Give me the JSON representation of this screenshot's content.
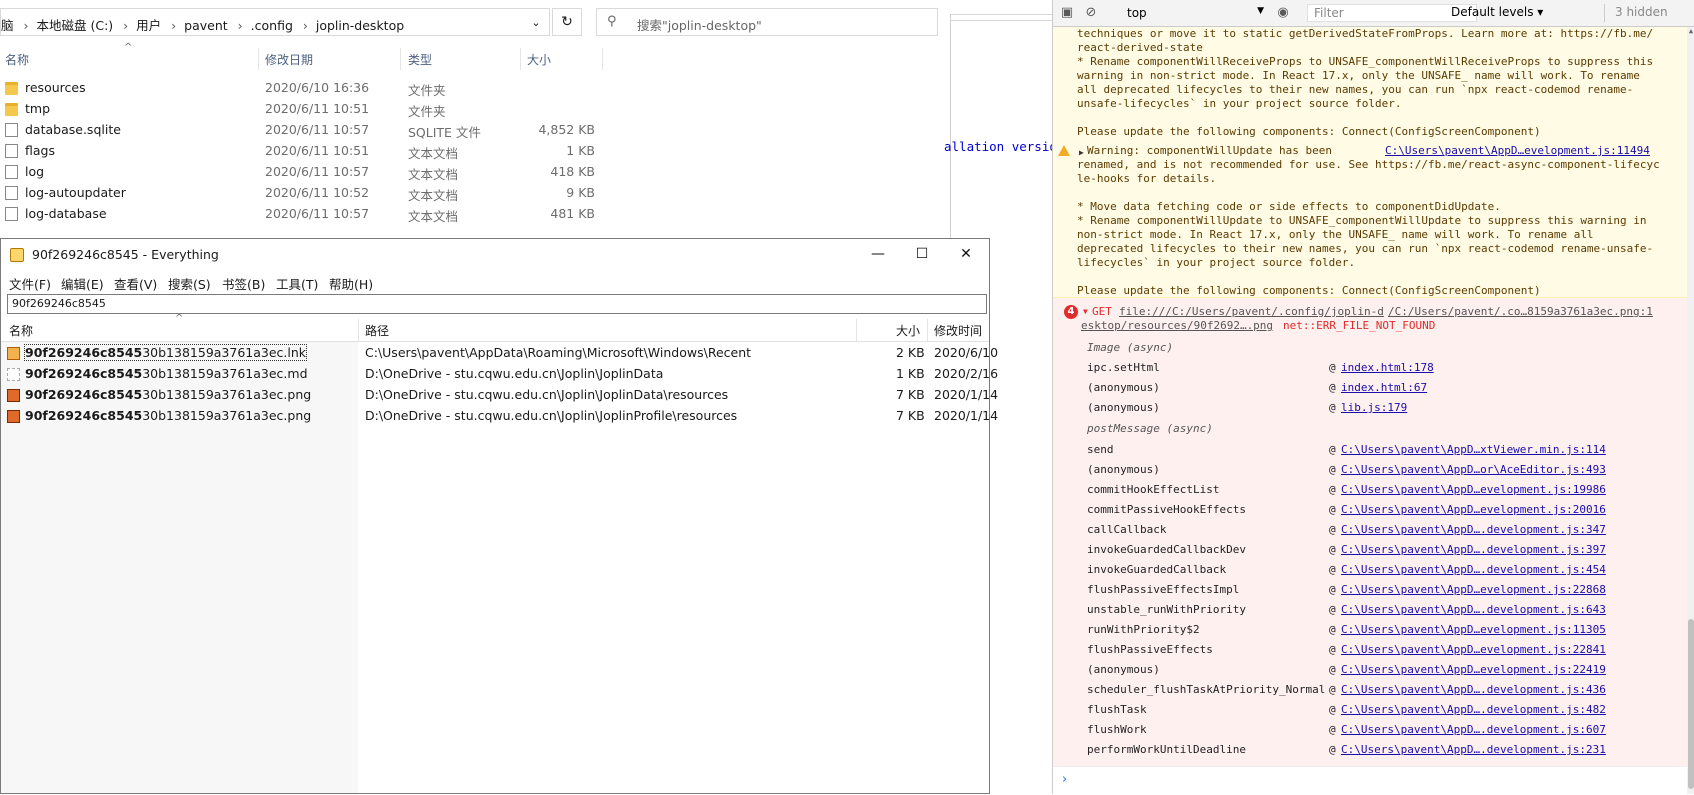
{
  "explorer": {
    "breadcrumbs": [
      "脑",
      "本地磁盘 (C:)",
      "用户",
      "pavent",
      ".config",
      "joplin-desktop"
    ],
    "search_placeholder": "搜索\"joplin-desktop\"",
    "columns": {
      "name": "名称",
      "date": "修改日期",
      "type": "类型",
      "size": "大小"
    },
    "rows": [
      {
        "name": "resources",
        "date": "2020/6/10 16:36",
        "type": "文件夹",
        "size": "",
        "icon": "folder-icon"
      },
      {
        "name": "tmp",
        "date": "2020/6/11 10:51",
        "type": "文件夹",
        "size": "",
        "icon": "folder-icon"
      },
      {
        "name": "database.sqlite",
        "date": "2020/6/11 10:57",
        "type": "SQLITE 文件",
        "size": "4,852 KB",
        "icon": "file-icon"
      },
      {
        "name": "flags",
        "date": "2020/6/11 10:51",
        "type": "文本文档",
        "size": "1 KB",
        "icon": "file-icon"
      },
      {
        "name": "log",
        "date": "2020/6/11 10:57",
        "type": "文本文档",
        "size": "418 KB",
        "icon": "file-icon"
      },
      {
        "name": "log-autoupdater",
        "date": "2020/6/11 10:52",
        "type": "文本文档",
        "size": "9 KB",
        "icon": "file-icon"
      },
      {
        "name": "log-database",
        "date": "2020/6/11 10:57",
        "type": "文本文档",
        "size": "481 KB",
        "icon": "file-icon"
      }
    ],
    "clipped_text": "allation versio"
  },
  "everything": {
    "title": "90f269246c8545 - Everything",
    "menu": [
      "文件(F)",
      "编辑(E)",
      "查看(V)",
      "搜索(S)",
      "书签(B)",
      "工具(T)",
      "帮助(H)"
    ],
    "search_value": "90f269246c8545",
    "columns": {
      "name": "名称",
      "path": "路径",
      "size": "大小",
      "modified": "修改时间"
    },
    "rows": [
      {
        "match": "90f269246c8545",
        "rest": "30b138159a3761a3ec.lnk",
        "path": "C:\\Users\\pavent\\AppData\\Roaming\\Microsoft\\Windows\\Recent",
        "size": "2 KB",
        "modified": "2020/6/10",
        "icon": "shortcut-icon"
      },
      {
        "match": "90f269246c8545",
        "rest": "30b138159a3761a3ec.md",
        "path": "D:\\OneDrive - stu.cqwu.edu.cn\\Joplin\\JoplinData",
        "size": "1 KB",
        "modified": "2020/2/16",
        "icon": "markdown-file-icon"
      },
      {
        "match": "90f269246c8545",
        "rest": "30b138159a3761a3ec.png",
        "path": "D:\\OneDrive - stu.cqwu.edu.cn\\Joplin\\JoplinData\\resources",
        "size": "7 KB",
        "modified": "2020/1/14",
        "icon": "image-file-icon"
      },
      {
        "match": "90f269246c8545",
        "rest": "30b138159a3761a3ec.png",
        "path": "D:\\OneDrive - stu.cqwu.edu.cn\\Joplin\\JoplinProfile\\resources",
        "size": "7 KB",
        "modified": "2020/1/14",
        "icon": "image-file-icon"
      }
    ]
  },
  "devtools": {
    "context": "top",
    "filter_placeholder": "Filter",
    "levels": "Default levels ▾",
    "hidden": "3 hidden",
    "warning_lines_top": [
      "techniques or move it to static getDerivedStateFromProps. Learn more at: https://fb.me/",
      "react-derived-state",
      "* Rename componentWillReceiveProps to UNSAFE_componentWillReceiveProps to suppress this",
      "warning in non-strict mode. In React 17.x, only the UNSAFE_ name will work. To rename",
      "all deprecated lifecycles to their new names, you can run `npx react-codemod rename-",
      "unsafe-lifecycles` in your project source folder.",
      "",
      "Please update the following components: Connect(ConfigScreenComponent)"
    ],
    "warning2": {
      "head": "Warning: componentWillUpdate has been",
      "source": "C:\\Users\\pavent\\AppD…evelopment.js:11494",
      "lines": [
        "renamed, and is not recommended for use. See https://fb.me/react-async-component-lifecyc",
        "le-hooks for details.",
        "",
        "* Move data fetching code or side effects to componentDidUpdate.",
        "* Rename componentWillUpdate to UNSAFE_componentWillUpdate to suppress this warning in",
        "non-strict mode. In React 17.x, only the UNSAFE_ name will work. To rename all",
        "deprecated lifecycles to their new names, you can run `npx react-codemod rename-unsafe-",
        "lifecycles` in your project source folder.",
        "",
        "Please update the following components: Connect(ConfigScreenComponent)"
      ]
    },
    "error": {
      "badge": "4",
      "method": "GET",
      "url": "file:///C:/Users/pavent/.config/joplin-d",
      "source": "/C:/Users/pavent/.co…8159a3761a3ec.png:1",
      "line2_url": "esktop/resources/90f2692….png",
      "line2_err": "net::ERR_FILE_NOT_FOUND",
      "stack": [
        {
          "kind": "async",
          "fn": "Image (async)"
        },
        {
          "fn": "ipc.setHtml",
          "loc": "index.html:178"
        },
        {
          "fn": "(anonymous)",
          "loc": "index.html:67"
        },
        {
          "fn": "(anonymous)",
          "loc": "lib.js:179"
        },
        {
          "kind": "async",
          "fn": "postMessage (async)"
        },
        {
          "fn": "send",
          "loc": "C:\\Users\\pavent\\AppD…xtViewer.min.js:114"
        },
        {
          "fn": "(anonymous)",
          "loc": "C:\\Users\\pavent\\AppD…or\\AceEditor.js:493"
        },
        {
          "fn": "commitHookEffectList",
          "loc": "C:\\Users\\pavent\\AppD…evelopment.js:19986"
        },
        {
          "fn": "commitPassiveHookEffects",
          "loc": "C:\\Users\\pavent\\AppD…evelopment.js:20016"
        },
        {
          "fn": "callCallback",
          "loc": "C:\\Users\\pavent\\AppD….development.js:347"
        },
        {
          "fn": "invokeGuardedCallbackDev",
          "loc": "C:\\Users\\pavent\\AppD….development.js:397"
        },
        {
          "fn": "invokeGuardedCallback",
          "loc": "C:\\Users\\pavent\\AppD….development.js:454"
        },
        {
          "fn": "flushPassiveEffectsImpl",
          "loc": "C:\\Users\\pavent\\AppD…evelopment.js:22868"
        },
        {
          "fn": "unstable_runWithPriority",
          "loc": "C:\\Users\\pavent\\AppD….development.js:643"
        },
        {
          "fn": "runWithPriority$2",
          "loc": "C:\\Users\\pavent\\AppD…evelopment.js:11305"
        },
        {
          "fn": "flushPassiveEffects",
          "loc": "C:\\Users\\pavent\\AppD…evelopment.js:22841"
        },
        {
          "fn": "(anonymous)",
          "loc": "C:\\Users\\pavent\\AppD…evelopment.js:22419"
        },
        {
          "fn": "scheduler_flushTaskAtPriority_Normal",
          "loc": "C:\\Users\\pavent\\AppD….development.js:436"
        },
        {
          "fn": "flushTask",
          "loc": "C:\\Users\\pavent\\AppD….development.js:482"
        },
        {
          "fn": "flushWork",
          "loc": "C:\\Users\\pavent\\AppD….development.js:607"
        },
        {
          "fn": "performWorkUntilDeadline",
          "loc": "C:\\Users\\pavent\\AppD….development.js:231"
        }
      ]
    },
    "prompt": "›",
    "colors": {
      "warning_bg": "#fffbe5",
      "error_bg": "#fff0f0",
      "error_red": "#e02a2a",
      "link": "#1a0dab"
    }
  }
}
